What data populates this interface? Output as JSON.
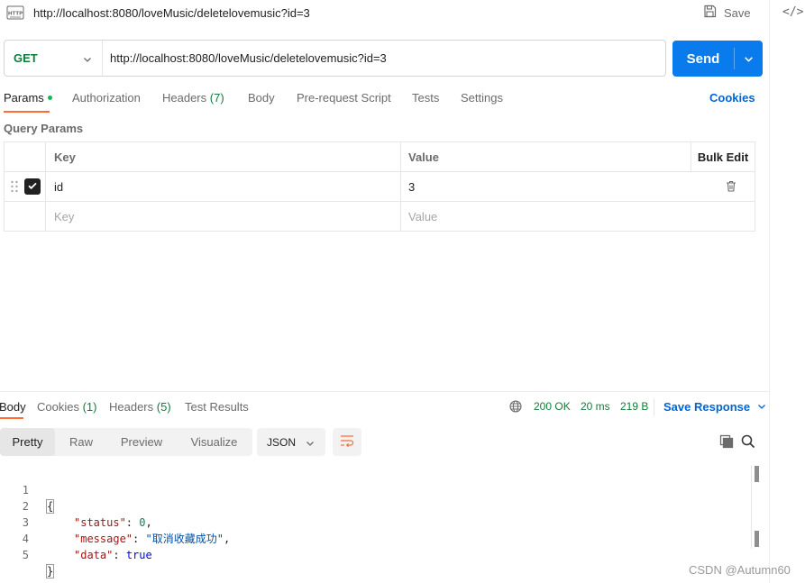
{
  "titlebar": {
    "title": "http://localhost:8080/loveMusic/deletelovemusic?id=3",
    "save_label": "Save"
  },
  "request": {
    "method": "GET",
    "url": "http://localhost:8080/loveMusic/deletelovemusic?id=3",
    "send_label": "Send"
  },
  "request_tabs": {
    "params": "Params",
    "authorization": "Authorization",
    "headers": "Headers",
    "headers_count": "(7)",
    "body": "Body",
    "prerequest": "Pre-request Script",
    "tests": "Tests",
    "settings": "Settings",
    "cookies": "Cookies"
  },
  "query_params": {
    "title": "Query Params",
    "columns": {
      "key": "Key",
      "value": "Value",
      "bulk_edit": "Bulk Edit"
    },
    "rows": [
      {
        "key": "id",
        "value": "3",
        "enabled": true
      }
    ],
    "key_placeholder": "Key",
    "value_placeholder": "Value"
  },
  "response_tabs": {
    "body": "Body",
    "cookies": "Cookies",
    "cookies_count": "(1)",
    "headers": "Headers",
    "headers_count": "(5)",
    "test_results": "Test Results"
  },
  "response_meta": {
    "status": "200 OK",
    "time": "20 ms",
    "size": "219 B",
    "save_response": "Save Response"
  },
  "view_modes": {
    "pretty": "Pretty",
    "raw": "Raw",
    "preview": "Preview",
    "visualize": "Visualize",
    "format": "JSON"
  },
  "code": {
    "line_numbers": [
      "1",
      "2",
      "3",
      "4",
      "5"
    ],
    "open_brace": "{",
    "close_brace": "}",
    "status_key": "\"status\"",
    "status_val": "0",
    "message_key": "\"message\"",
    "message_val": "\"取消收藏成功\"",
    "data_key": "\"data\"",
    "data_val": "true"
  },
  "watermark": "CSDN @Autumn60",
  "colors": {
    "accent": "#097bed",
    "tab_indicator": "#ff6c37",
    "method_get": "#0f7e3a",
    "link": "#0265d2"
  },
  "icons": [
    "http-icon",
    "save-icon",
    "code-icon",
    "chevron-down-icon",
    "drag-handle-icon",
    "check-icon",
    "trash-icon",
    "globe-icon",
    "wrap-lines-icon",
    "copy-icon",
    "search-icon"
  ]
}
